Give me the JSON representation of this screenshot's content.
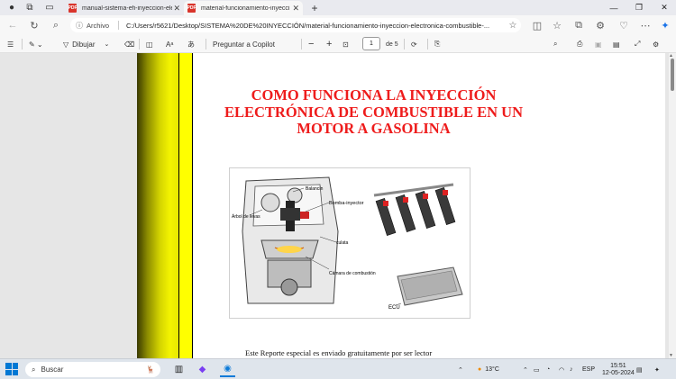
{
  "tabs": [
    {
      "title": "manual-sistema-efi-inyeccion-ele",
      "active": false
    },
    {
      "title": "material-funcionamiento-inyecci",
      "active": true
    }
  ],
  "address": {
    "label": "Archivo",
    "url": "C:/Users/r5621/Desktop/SISTEMA%20DE%20INYECCIÓN/material-funcionamiento-inyeccion-electronica-combustible-..."
  },
  "pdf_toolbar": {
    "draw_label": "Dibujar",
    "copilot_label": "Preguntar a Copilot",
    "page_current": "1",
    "page_total": "de 5"
  },
  "document": {
    "title": "COMO FUNCIONA LA INYECCIÓN ELECTRÓNICA DE COMBUSTIBLE EN UN MOTOR A GASOLINA",
    "figure_labels": {
      "balancin": "Balancín",
      "bomba": "Bomba-inyector",
      "arbol": "Árbol de levas",
      "culata": "culata",
      "camara": "Cámara de combustión",
      "ecu": "ECU"
    },
    "footer_text": "Este Reporte especial es enviado gratuitamente por ser lector"
  },
  "taskbar": {
    "search_placeholder": "Buscar",
    "weather": "13°C",
    "language": "ESP",
    "time": "15:51",
    "date": "12-05-2024"
  }
}
